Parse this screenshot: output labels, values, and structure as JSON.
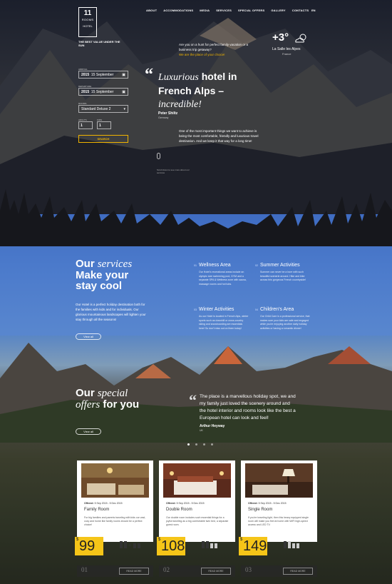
{
  "logo": {
    "number": "11",
    "word": "ROOMS",
    "sub": "HOTEL"
  },
  "tagline": "The best value under the sun",
  "nav": {
    "items": [
      "About",
      "Accommodations",
      "Media",
      "Services",
      "Special offers",
      "Gallery",
      "Contacts"
    ],
    "lang": "EN"
  },
  "booking": {
    "arrival_label": "Arrival",
    "arrival_year": "2015",
    "arrival_date": "15 September",
    "departure_label": "Departure",
    "departure_year": "2015",
    "departure_date": "15 September",
    "room_label": "Rooms",
    "room_value": "Standard Deluxe 2",
    "adults_label": "Adults",
    "adults_value": "1",
    "kids_label": "Kids",
    "kids_value": "1",
    "search_label": "SEARCH"
  },
  "hero": {
    "intro": "Are you on a hunt for perfect family vacation or a business trip getaway?",
    "intro_highlight": "We are the place of your choice!",
    "quote_italic": "Luxurious",
    "quote_rest": "hotel in French Alps –",
    "quote_end": "incredible!",
    "author": "Peter Shiltz",
    "author_country": "Germany",
    "description": "One of the most important things we want to achieve is being the most comfortable, friendly and luxurious travel destination. And we keep it that way for a long time!",
    "scroll_hint": "Scroll down to see more about our services"
  },
  "weather": {
    "temp": "+3°",
    "location": "La Salle les Alpes",
    "country": "France"
  },
  "services": {
    "title_1": "Our",
    "title_italic": "services",
    "title_2": "Make your stay cool",
    "description": "Our Hotel is a perfect holiday destination both for the families with kids and for individuals. Our glorious mountainous landscapes will lighten your stay through all the seasons!",
    "view_all": "View all",
    "items": [
      {
        "num": "01",
        "title": "Wellness Area",
        "desc": "Our Hotel's recreational areas include an olympic size swimming pool, GYM and a separate SPA & Wellness zone with sauna, massage rooms and hot tubs."
      },
      {
        "num": "02",
        "title": "Summer Activities",
        "desc": "Summer can never be a bore with such beautiful scenerie around. Hike and bike across this gorgeous French countryside!"
      },
      {
        "num": "03",
        "title": "Winter Activities",
        "desc": "As our Hotel is located in French Alps, winter sports such as downhill or cross-country skiing and snowboarding are essentials here! So don't miss out on them today!"
      },
      {
        "num": "04",
        "title": "Children's Area",
        "desc": "Our Child Care is a professional service, that makes sure your kids are safe and engaged while you're enjoying another daily holiday activities or having a romantic dinner!"
      }
    ]
  },
  "offers": {
    "title_1": "Our",
    "title_italic": "special",
    "title_2": "offers",
    "title_3": "for you",
    "view_all": "View all",
    "quote": "The place is a marvellous holiday spot, we and my family just loved the scenery around and the hotel interior and rooms look like the best a European hotel can look and feel!",
    "author": "Arthur Heyway",
    "author_country": "UK"
  },
  "cards": [
    {
      "offered_label": "Offered:",
      "dates": "5 Sep 2015 - 5 Dec 2015",
      "title": "Family Room",
      "desc": "For big families and parents traveling with kids our vast, cozy and home like family rooms should be a perfect choice!",
      "currency": "$",
      "price": "99",
      "num": "01",
      "more": "READ MORE"
    },
    {
      "offered_label": "Offered:",
      "dates": "5 Sep 2015 - 5 Dec 2015",
      "title": "Double Room",
      "desc": "Our double room includes such essential things for a joyful traveling as a big comfortable twin bed, a separate guest room.",
      "currency": "$",
      "price": "108",
      "num": "02",
      "more": "READ MORE"
    },
    {
      "offered_label": "Offered:",
      "dates": "5 Sep 2015 - 5 Dec 2015",
      "title": "Single Room",
      "desc": "If you're traveling light, then this heavy equipped single room will make you feel at home with WiFi high-speed access and LED TV.",
      "currency": "$",
      "price": "149",
      "num": "03",
      "more": "READ MORE"
    }
  ],
  "colors": {
    "accent": "#f5c518",
    "blue": "#4b7acb"
  }
}
